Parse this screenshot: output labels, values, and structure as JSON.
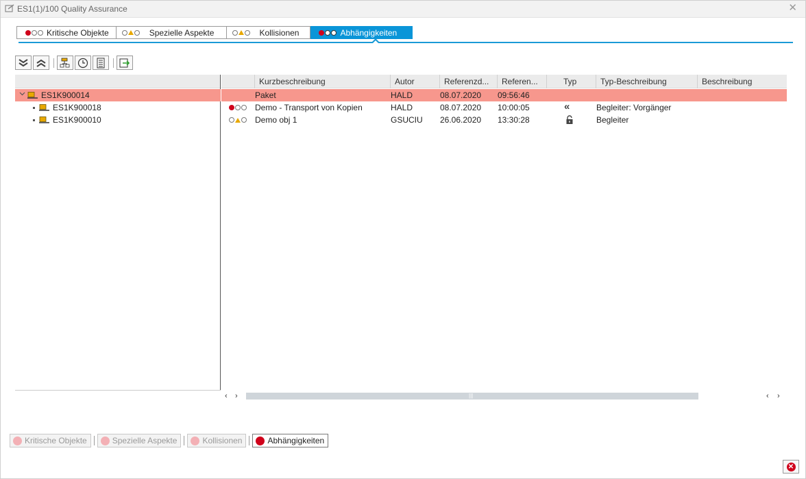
{
  "window": {
    "title": "ES1(1)/100 Quality Assurance",
    "close_glyph": "✕"
  },
  "tabs": [
    {
      "label": "Kritische Objekte",
      "icon": "red-grey-grey-dots-icon"
    },
    {
      "label": "Spezielle Aspekte",
      "icon": "grey-triangle-grey-icon"
    },
    {
      "label": "Kollisionen",
      "icon": "grey-triangle-grey-icon"
    },
    {
      "label": "Abhängigkeiten",
      "icon": "red-grey-grey-dots-icon",
      "active": true
    }
  ],
  "toolbar": {
    "buttons": [
      "expand-all-icon",
      "collapse-all-icon",
      "hierarchy-icon",
      "clock-icon",
      "document-icon",
      "export-icon"
    ]
  },
  "tree": {
    "rows": [
      {
        "label": "ES1K900014",
        "selected": true,
        "expanded": true
      },
      {
        "label": "ES1K900018"
      },
      {
        "label": "ES1K900010"
      }
    ]
  },
  "grid": {
    "columns": [
      "Kurzbeschreibung",
      "Autor",
      "Referenzd...",
      "Referen...",
      "Typ",
      "Typ-Beschreibung",
      "Beschreibung"
    ],
    "rows": [
      {
        "status": "",
        "kurz": "Paket",
        "autor": "HALD",
        "datum": "08.07.2020",
        "zeit": "09:56:46",
        "typ": "",
        "typbeschr": "",
        "beschr": "",
        "selected": true
      },
      {
        "status": "red-grey-grey-dots-icon",
        "kurz": "Demo - Transport von Kopien",
        "autor": "HALD",
        "datum": "08.07.2020",
        "zeit": "10:00:05",
        "typ": "«",
        "typ_icon": "double-chevron-left-icon",
        "typbeschr": "Begleiter: Vorgänger",
        "beschr": ""
      },
      {
        "status": "grey-triangle-grey-icon",
        "kurz": "Demo obj 1",
        "autor": "GSUCIU",
        "datum": "26.06.2020",
        "zeit": "13:30:28",
        "typ": "",
        "typ_icon": "unlocked-icon",
        "typbeschr": "Begleiter",
        "beschr": ""
      }
    ]
  },
  "scrollbar": {
    "left": "‹",
    "right": "›",
    "grip": "|||"
  },
  "bottom_buttons": [
    {
      "label": "Kritische Objekte"
    },
    {
      "label": "Spezielle Aspekte"
    },
    {
      "label": "Kollisionen"
    },
    {
      "label": "Abhängigkeiten",
      "active": true
    }
  ],
  "colors": {
    "accent": "#0a95d8",
    "selection": "#f7978d",
    "status_red": "#d0021b",
    "status_yellow": "#e8a800"
  }
}
